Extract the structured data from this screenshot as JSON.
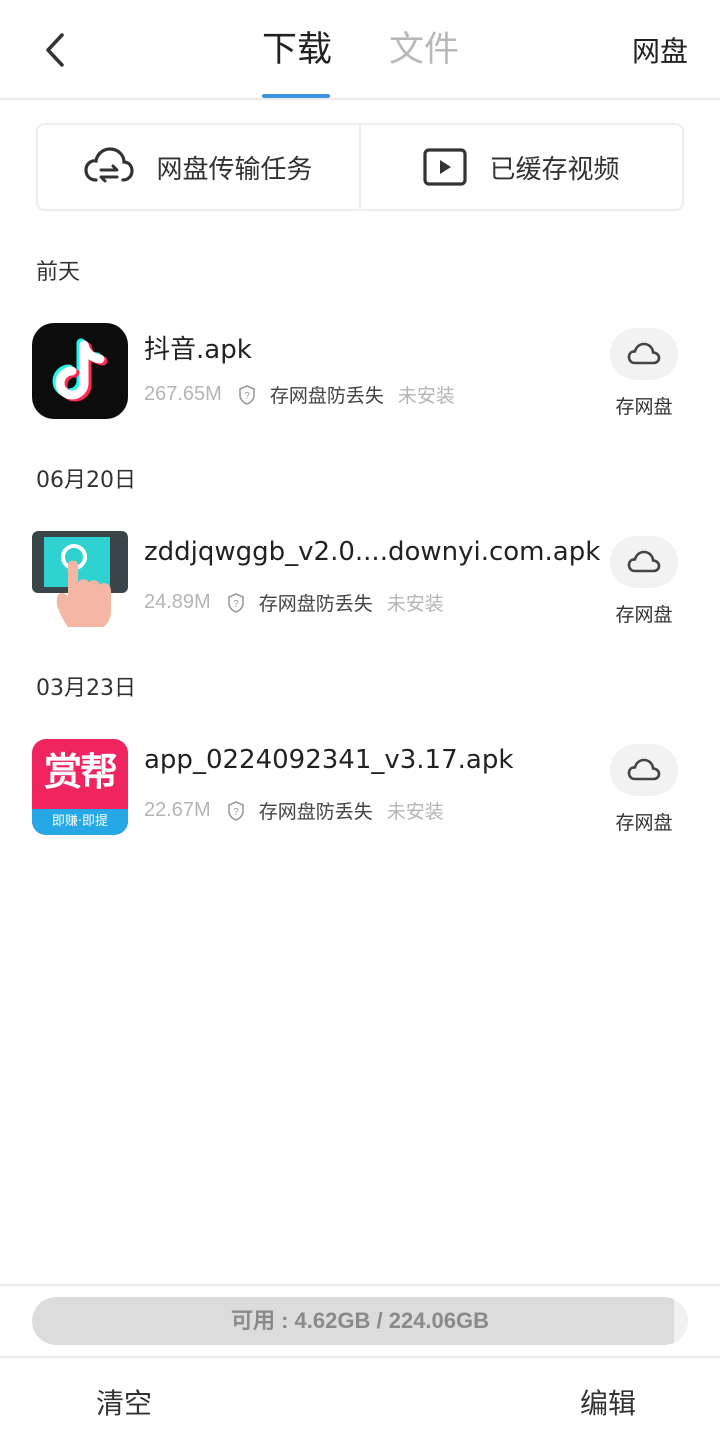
{
  "header": {
    "tabs": [
      {
        "label": "下载",
        "active": true
      },
      {
        "label": "文件",
        "active": false
      }
    ],
    "right_link": "网盘",
    "back_icon": "chevron-left-icon",
    "accent_color": "#3e96e0"
  },
  "quick_actions": [
    {
      "label": "网盘传输任务",
      "icon": "cloud-transfer-icon"
    },
    {
      "label": "已缓存视频",
      "icon": "video-play-icon"
    }
  ],
  "groups": [
    {
      "date": "前天",
      "items": [
        {
          "name": "抖音.apk",
          "size": "267.65M",
          "protect": "存网盘防丢失",
          "status": "未安装",
          "save_label": "存网盘",
          "icon": "tiktok-app-icon"
        }
      ]
    },
    {
      "date": "06月20日",
      "items": [
        {
          "name": "zddjqwggb_v2.0....downyi.com.apk",
          "size": "24.89M",
          "protect": "存网盘防丢失",
          "status": "未安装",
          "save_label": "存网盘",
          "icon": "tap-app-icon"
        }
      ]
    },
    {
      "date": "03月23日",
      "items": [
        {
          "name": "app_0224092341_v3.17.apk",
          "size": "22.67M",
          "protect": "存网盘防丢失",
          "status": "未安装",
          "save_label": "存网盘",
          "icon": "shangbang-app-icon",
          "icon_text": "赏帮",
          "icon_subtext": "即赚·即提"
        }
      ]
    }
  ],
  "storage": {
    "text": "可用 : 4.62GB / 224.06GB",
    "used_fraction": 0.979
  },
  "bottom": {
    "clear_label": "清空",
    "edit_label": "编辑"
  }
}
